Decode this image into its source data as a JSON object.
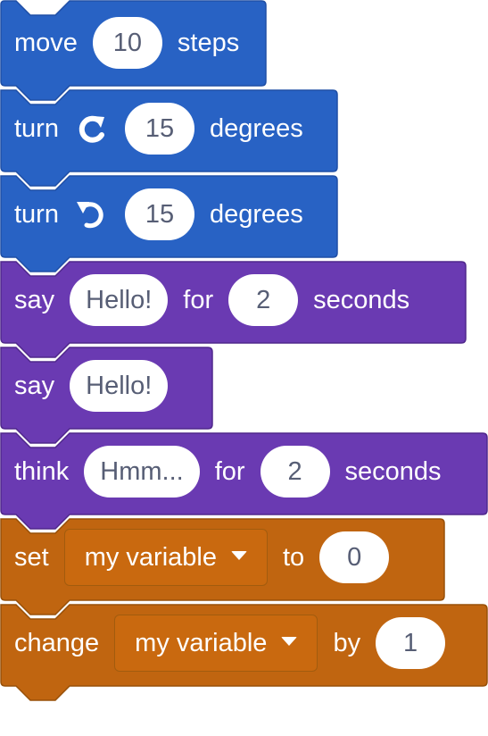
{
  "colors": {
    "motion": "#2862c4",
    "motion_border": "#1f4fa6",
    "looks": "#6a3ab2",
    "looks_border": "#50288c",
    "variables": "#c06510",
    "variables_border": "#985008",
    "field_text": "#575e75"
  },
  "blocks": [
    {
      "category": "motion",
      "text": [
        "move",
        "steps"
      ],
      "input": "10"
    },
    {
      "category": "motion",
      "text": [
        "turn",
        "degrees"
      ],
      "icon": "rotate-right-icon",
      "input": "15"
    },
    {
      "category": "motion",
      "text": [
        "turn",
        "degrees"
      ],
      "icon": "rotate-left-icon",
      "input": "15"
    },
    {
      "category": "looks",
      "text": [
        "say",
        "for",
        "seconds"
      ],
      "inputs": [
        "Hello!",
        "2"
      ]
    },
    {
      "category": "looks",
      "text": [
        "say"
      ],
      "input": "Hello!"
    },
    {
      "category": "looks",
      "text": [
        "think",
        "for",
        "seconds"
      ],
      "inputs": [
        "Hmm...",
        "2"
      ]
    },
    {
      "category": "variables",
      "text": [
        "set",
        "to"
      ],
      "dropdown": "my variable",
      "input": "0"
    },
    {
      "category": "variables",
      "text": [
        "change",
        "by"
      ],
      "dropdown": "my variable",
      "input": "1"
    }
  ]
}
